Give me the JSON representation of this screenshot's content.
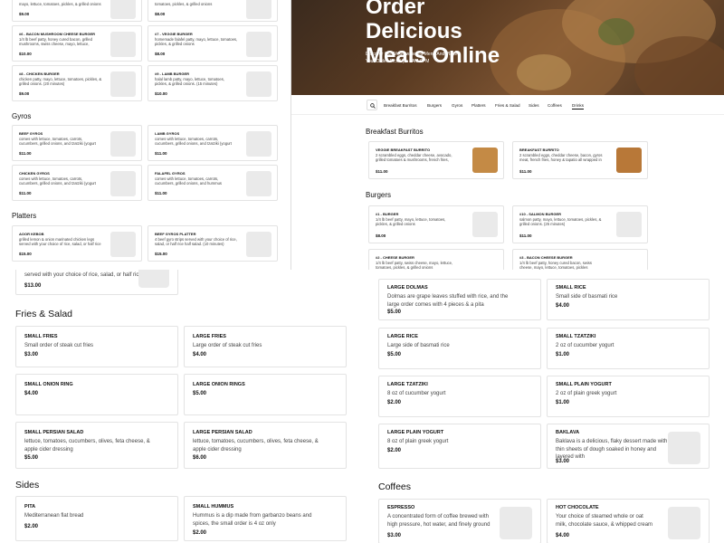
{
  "top_left": {
    "cards": [
      {
        "title": "",
        "desc": "mayo, lettuce, tomatoes, pickles, & grilled onions",
        "price": "$9.00"
      },
      {
        "title": "",
        "desc": "tomatoes, pickles, & grilled onions",
        "price": "$8.00"
      },
      {
        "title": "#6 - BACON MUSHROOM CHEESE BURGER",
        "desc": "1/4 lb beef patty, honey cured bacon, grilled mushrooms, swiss cheese, mayo, lettuce,",
        "price": "$10.00"
      },
      {
        "title": "#7 - VEGGIE BURGER",
        "desc": "homemade falafel patty, mayo, lettuce, tomatoes, pickles, & grilled onions",
        "price": "$8.00"
      },
      {
        "title": "#8 - CHICKEN BURGER",
        "desc": "chicken patty, mayo, lettuce, tomatoes, pickles, & grilled onions. (20 minutes)",
        "price": "$9.00"
      },
      {
        "title": "#9 - LAMB BURGER",
        "desc": "halal lamb patty, mayo, lettuce, tomatoes, pickles, & grilled onions. (15 minutes)",
        "price": "$10.00"
      }
    ],
    "gyros_heading": "Gyros",
    "gyros": [
      {
        "title": "BEEF GYROS",
        "desc": "comes with lettuce, tomatoes, carrots, cucumbers, grilled onions, and tzatziki (yogurt",
        "price": "$11.00"
      },
      {
        "title": "LAMB GYROS",
        "desc": "comes with lettuce, tomatoes, carrots, cucumbers, grilled onions, and tzatziki (yogurt",
        "price": "$11.00"
      },
      {
        "title": "CHICKEN GYROS",
        "desc": "comes with lettuce, tomatoes, carrots, cucumbers, grilled onions, and tzatziki (yogurt",
        "price": "$11.00"
      },
      {
        "title": "FALAFEL GYROS",
        "desc": "comes with lettuce, tomatoes, carrots, cucumbers, grilled onions, and hummus",
        "price": "$11.00"
      }
    ],
    "platters_heading": "Platters",
    "platters": [
      {
        "title": "AOOR KEBOB",
        "desc": "grilled lemon & onion marinated chicken legs served with your choice of rice, salad, or half rice",
        "price": "$15.00"
      },
      {
        "title": "BEEF GYROS PLATTER",
        "desc": "4 beef gyro strips served with your choice of rice, salad, or half rice half salad. (10 minutes)",
        "price": "$15.00"
      }
    ]
  },
  "hero": {
    "title": "Order Delicious Meals Online",
    "subtitle": "Discover Our Mouthwatering Menu And Place Your Order. Pick Up : 8AM-9PM"
  },
  "nav": {
    "items": [
      "Breakfast Burritos",
      "Burgers",
      "Gyros",
      "Platters",
      "Fries & Salad",
      "Sides",
      "Coffees",
      "Drinks"
    ]
  },
  "top_right": {
    "breakfast_heading": "Breakfast Burritos",
    "breakfast": [
      {
        "title": "VEGGIE BREAKFAST BURRITO",
        "desc": "2 scrambled eggs, cheddar cheese, avocado, grilled tomatoes & mushrooms, french fries,",
        "price": "$11.00"
      },
      {
        "title": "BREAKFAST BURRITO",
        "desc": "2 scrambled eggs, cheddar cheese, bacon, gyros meat, french fries, honey & tapatio all wrapped in",
        "price": "$11.00"
      }
    ],
    "burgers_heading": "Burgers",
    "burgers": [
      {
        "title": "#1 - BURGER",
        "desc": "1/4 lb beef patty, mayo, lettuce, tomatoes, pickles, & grilled onions",
        "price": "$8.00"
      },
      {
        "title": "#10 - SALMON BURGER",
        "desc": "salmon patty, mayo, lettuce, tomatoes, pickles, & grilled onions. (25 minutes)",
        "price": "$11.00"
      },
      {
        "title": "#2 - CHEESE BURGER",
        "desc": "1/4 lb beef patty, swiss cheese, mayo, lettuce, tomatoes, pickles, & grilled onions",
        "price": ""
      },
      {
        "title": "#3 - BACON CHEESE BURGER",
        "desc": "1/4 lb beef patty, honey cured bacon, swiss cheese, mayo, lettuce, tomatoes, pickles",
        "price": ""
      }
    ]
  },
  "bottom_left": {
    "partial_card": {
      "desc": "served with your choice of rice, salad, or half rice...",
      "price": "$13.00"
    },
    "fries_heading": "Fries & Salad",
    "fries": [
      {
        "title": "SMALL FRIES",
        "desc": "Small order of steak cut fries",
        "price": "$3.00"
      },
      {
        "title": "LARGE FRIES",
        "desc": "Large order of steak cut fries",
        "price": "$4.00"
      },
      {
        "title": "SMALL ONION RING",
        "desc": "",
        "price": "$4.00"
      },
      {
        "title": "LARGE ONION RINGS",
        "desc": "",
        "price": "$5.00"
      },
      {
        "title": "SMALL PERSIAN SALAD",
        "desc": "lettuce, tomatoes, cucumbers, olives, feta cheese, & apple cider dressing",
        "price": "$5.00"
      },
      {
        "title": "LARGE PERSIAN SALAD",
        "desc": "lettuce, tomatoes, cucumbers, olives, feta cheese, & apple cider dressing",
        "price": "$6.00"
      }
    ],
    "sides_heading": "Sides",
    "sides": [
      {
        "title": "PITA",
        "desc": "Mediterranean flat bread",
        "price": "$2.00"
      },
      {
        "title": "SMALL HUMMUS",
        "desc": "Hummus is a dip made from garbanzo beans and spices, the small order is 4 oz only",
        "price": "$2.00"
      }
    ]
  },
  "bottom_right": {
    "items": [
      {
        "title": "LARGE DOLMAS",
        "desc": "Dolmas are grape leaves stuffed with rice, and the large order comes with 4 pieces & a pita",
        "price": "$5.00"
      },
      {
        "title": "SMALL RICE",
        "desc": "Small side of basmati rice",
        "price": "$4.00"
      },
      {
        "title": "LARGE RICE",
        "desc": "Large side of basmati rice",
        "price": "$5.00"
      },
      {
        "title": "SMALL TZATZIKI",
        "desc": "2 oz of cucumber yogurt",
        "price": "$1.00"
      },
      {
        "title": "LARGE TZATZIKI",
        "desc": "8 oz of cucumber yogurt",
        "price": "$2.00"
      },
      {
        "title": "SMALL PLAIN YOGURT",
        "desc": "2 oz of plain greek yogurt",
        "price": "$1.00"
      },
      {
        "title": "LARGE PLAIN YOGURT",
        "desc": "8 oz of plain greek yogurt",
        "price": "$2.00"
      },
      {
        "title": "BAKLAVA",
        "desc": "Baklava is a delicious, flaky dessert made with thin sheets of dough soaked in honey and layered with",
        "price": "$3.00"
      }
    ],
    "coffees_heading": "Coffees",
    "coffees": [
      {
        "title": "ESPRESSO",
        "desc": "A concentrated form of coffee brewed with high pressure, hot water, and finely ground coffee",
        "price": "$3.00"
      },
      {
        "title": "HOT CHOCOLATE",
        "desc": "Your choice of steamed whole or oat milk, chocolate sauce, & whipped cream",
        "price": "$4.00"
      }
    ]
  },
  "icons": {
    "search": "search-icon"
  }
}
